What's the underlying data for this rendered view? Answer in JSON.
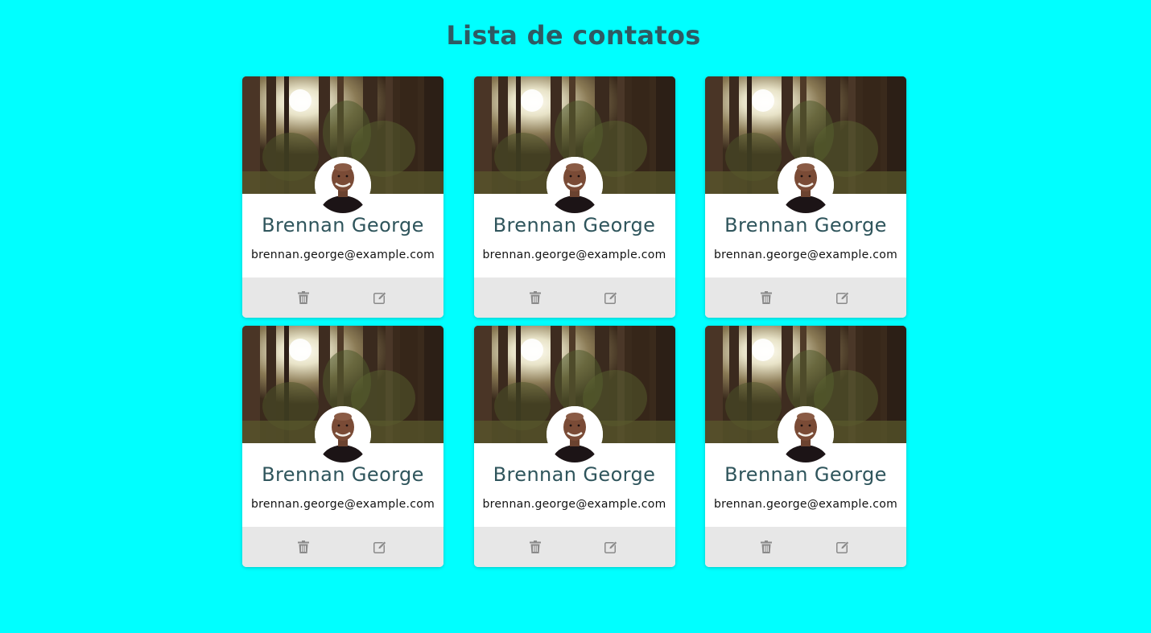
{
  "page": {
    "title": "Lista de contatos",
    "background": "#00ffff"
  },
  "contacts": [
    {
      "name": "Brennan George",
      "email": "brennan.george@example.com"
    },
    {
      "name": "Brennan George",
      "email": "brennan.george@example.com"
    },
    {
      "name": "Brennan George",
      "email": "brennan.george@example.com"
    },
    {
      "name": "Brennan George",
      "email": "brennan.george@example.com"
    },
    {
      "name": "Brennan George",
      "email": "brennan.george@example.com"
    },
    {
      "name": "Brennan George",
      "email": "brennan.george@example.com"
    }
  ],
  "card_actions": {
    "delete_icon": "trash-icon",
    "edit_icon": "edit-icon"
  },
  "colors": {
    "title": "#2e5a62",
    "name": "#2f555c",
    "actions_bar": "#e7e7e7",
    "icon": "#8a8a8a"
  }
}
